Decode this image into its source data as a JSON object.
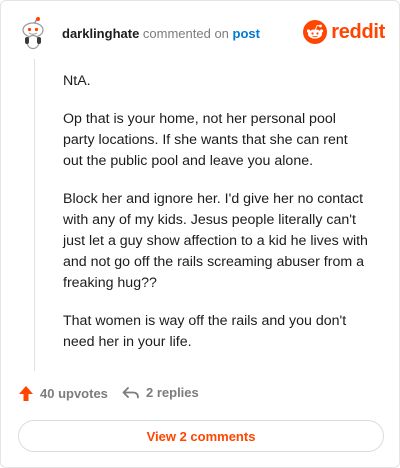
{
  "header": {
    "username": "darklinghate",
    "action_text": "commented on",
    "post_link": "post",
    "brand_wordmark": "reddit"
  },
  "comment": {
    "paragraphs": [
      "NtA.",
      "Op that is your home, not her personal pool party locations. If she wants that she can rent out the public pool and leave you alone.",
      "Block her and ignore her. I'd give her no contact with any of my kids. Jesus people literally can't just let a guy show affection to a kid he lives with and not go off the rails screaming abuser from a freaking hug??",
      "That women is way off the rails and you don't need her in your life."
    ]
  },
  "actions": {
    "upvotes_label": "40 upvotes",
    "replies_label": "2 replies"
  },
  "footer": {
    "view_comments_label": "View 2 comments"
  },
  "colors": {
    "brand": "#ff4500",
    "link": "#0079d3",
    "muted": "#7c7c7c"
  },
  "icons": {
    "avatar": "snoo-avatar-icon",
    "logo": "reddit-snoo-icon",
    "upvote": "upvote-arrow-icon",
    "reply": "reply-arrow-icon"
  }
}
